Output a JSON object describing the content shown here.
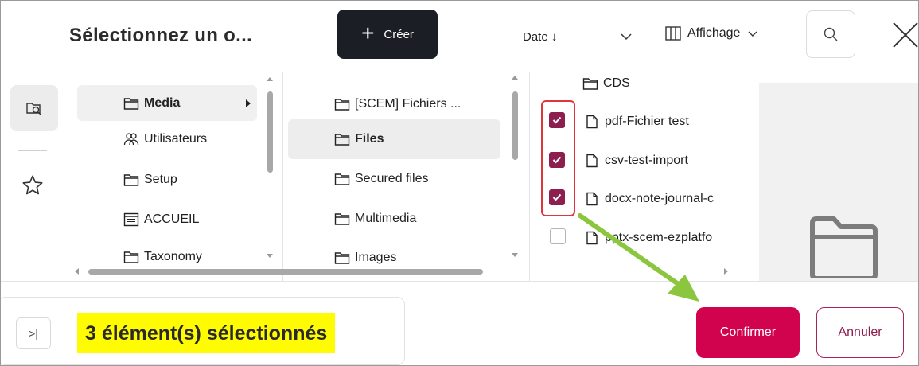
{
  "header": {
    "title": "Sélectionnez un o...",
    "create_label": "Créer",
    "sort_label": "Date ↓",
    "view_label": "Affichage"
  },
  "columns": {
    "col1": [
      {
        "label": "Media",
        "icon": "folder-icon",
        "bold": true,
        "has_children": true
      },
      {
        "label": "Utilisateurs",
        "icon": "users-icon"
      },
      {
        "label": "Setup",
        "icon": "folder-icon"
      },
      {
        "label": "ACCUEIL",
        "icon": "page-icon"
      },
      {
        "label": "Taxonomy",
        "icon": "folder-icon"
      }
    ],
    "col2": [
      {
        "label": "[SCEM] Fichiers ...",
        "icon": "folder-icon"
      },
      {
        "label": "Files",
        "icon": "folder-icon",
        "bold": true,
        "active": true
      },
      {
        "label": "Secured files",
        "icon": "folder-icon"
      },
      {
        "label": "Multimedia",
        "icon": "folder-icon"
      },
      {
        "label": "Images",
        "icon": "folder-icon"
      }
    ],
    "col3": [
      {
        "label": "CDS",
        "icon": "folder-icon",
        "checkbox": null
      },
      {
        "label": "pdf-Fichier test",
        "icon": "file-icon",
        "checkbox": "checked"
      },
      {
        "label": "csv-test-import",
        "icon": "file-icon",
        "checkbox": "checked"
      },
      {
        "label": "docx-note-journal-c",
        "icon": "file-icon",
        "checkbox": "checked"
      },
      {
        "label": "pptx-scem-ezplatfo",
        "icon": "file-icon",
        "checkbox": "unchecked"
      }
    ]
  },
  "footer": {
    "expand_label": ">|",
    "selected_text": "3 élément(s) sélectionnés",
    "confirm_label": "Confirmer",
    "cancel_label": "Annuler"
  },
  "colors": {
    "accent": "#d1034f",
    "checkbox_checked": "#8c1f4f",
    "highlight_red": "#e0363b",
    "annotation_green": "#8cc63f",
    "selected_highlight": "#fffb00"
  }
}
